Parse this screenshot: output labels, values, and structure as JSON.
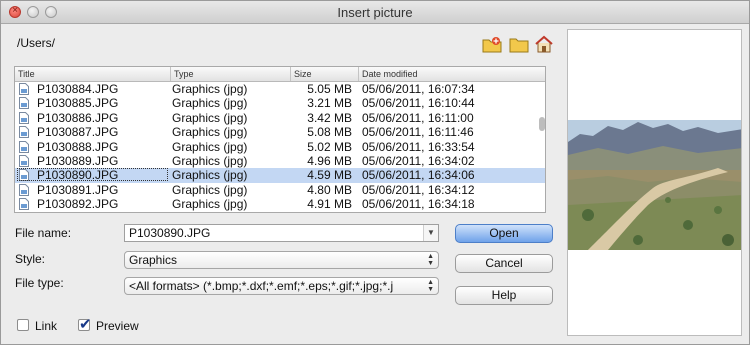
{
  "window": {
    "title": "Insert picture"
  },
  "path": "/Users/",
  "toolbar": {
    "new_folder_icon": "new-folder-icon",
    "folder_icon": "folder-icon",
    "home_icon": "home-icon"
  },
  "columns": [
    "Title",
    "Type",
    "Size",
    "Date modified"
  ],
  "files": [
    {
      "title": "P1030884.JPG",
      "type": "Graphics (jpg)",
      "size": "5.05 MB",
      "date": "05/06/2011, 16:07:34"
    },
    {
      "title": "P1030885.JPG",
      "type": "Graphics (jpg)",
      "size": "3.21 MB",
      "date": "05/06/2011, 16:10:44"
    },
    {
      "title": "P1030886.JPG",
      "type": "Graphics (jpg)",
      "size": "3.42 MB",
      "date": "05/06/2011, 16:11:00"
    },
    {
      "title": "P1030887.JPG",
      "type": "Graphics (jpg)",
      "size": "5.08 MB",
      "date": "05/06/2011, 16:11:46"
    },
    {
      "title": "P1030888.JPG",
      "type": "Graphics (jpg)",
      "size": "5.02 MB",
      "date": "05/06/2011, 16:33:54"
    },
    {
      "title": "P1030889.JPG",
      "type": "Graphics (jpg)",
      "size": "4.96 MB",
      "date": "05/06/2011, 16:34:02"
    },
    {
      "title": "P1030890.JPG",
      "type": "Graphics (jpg)",
      "size": "4.59 MB",
      "date": "05/06/2011, 16:34:06",
      "selected": true
    },
    {
      "title": "P1030891.JPG",
      "type": "Graphics (jpg)",
      "size": "4.80 MB",
      "date": "05/06/2011, 16:34:12"
    },
    {
      "title": "P1030892.JPG",
      "type": "Graphics (jpg)",
      "size": "4.91 MB",
      "date": "05/06/2011, 16:34:18"
    }
  ],
  "form": {
    "file_name_label": "File name:",
    "file_name_value": "P1030890.JPG",
    "style_label": "Style:",
    "style_value": "Graphics",
    "file_type_label": "File type:",
    "file_type_value": "<All formats> (*.bmp;*.dxf;*.emf;*.eps;*.gif;*.jpg;*.j"
  },
  "buttons": {
    "open": "Open",
    "cancel": "Cancel",
    "help": "Help"
  },
  "options": {
    "link_label": "Link",
    "link_checked": false,
    "preview_label": "Preview",
    "preview_checked": true
  },
  "colors": {
    "selection": "#c3d7f3",
    "default_button": "#6fa2ea"
  }
}
